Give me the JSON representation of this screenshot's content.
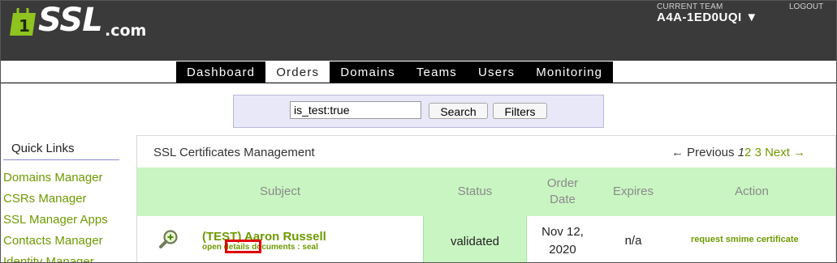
{
  "header": {
    "logo_text": "SSL",
    "logo_suffix": ".com",
    "team_label": "CURRENT TEAM",
    "team_name": "A4A-1ED0UQI ▼",
    "logout_label": "LOGOUT"
  },
  "nav": {
    "tabs": [
      {
        "label": "Dashboard",
        "active": false
      },
      {
        "label": "Orders",
        "active": true
      },
      {
        "label": "Domains",
        "active": false
      },
      {
        "label": "Teams",
        "active": false
      },
      {
        "label": "Users",
        "active": false
      },
      {
        "label": "Monitoring",
        "active": false
      }
    ]
  },
  "search": {
    "value": "is_test:true",
    "search_label": "Search",
    "filters_label": "Filters"
  },
  "sidebar": {
    "title": "Quick Links",
    "items": [
      {
        "label": "Domains Manager"
      },
      {
        "label": "CSRs Manager"
      },
      {
        "label": "SSL Manager Apps"
      },
      {
        "label": "Contacts Manager"
      },
      {
        "label": "Identity Manager"
      }
    ]
  },
  "panel": {
    "title": "SSL Certificates Management",
    "pager": {
      "prev_label": "← Previous",
      "current_page": "1",
      "pages": [
        "2",
        "3"
      ],
      "next_label": "Next →"
    }
  },
  "table": {
    "headers": {
      "subject": "Subject",
      "status": "Status",
      "order_date_line1": "Order",
      "order_date_line2": "Date",
      "expires": "Expires",
      "action": "Action"
    },
    "rows": [
      {
        "subject": "(TEST) Aaron Russell",
        "links": {
          "open": "open",
          "details": "details",
          "documents": "documents",
          "sep": ":",
          "seal": "seal"
        },
        "status": "validated",
        "order_date_line1": "Nov 12,",
        "order_date_line2": "2020",
        "expires": "n/a",
        "action": "request smime certificate"
      }
    ]
  },
  "colors": {
    "header_bg": "#3a3a3a",
    "accent_green": "#6e9a00",
    "table_header_bg": "#c9f5c2",
    "highlight_red": "#e00000"
  }
}
